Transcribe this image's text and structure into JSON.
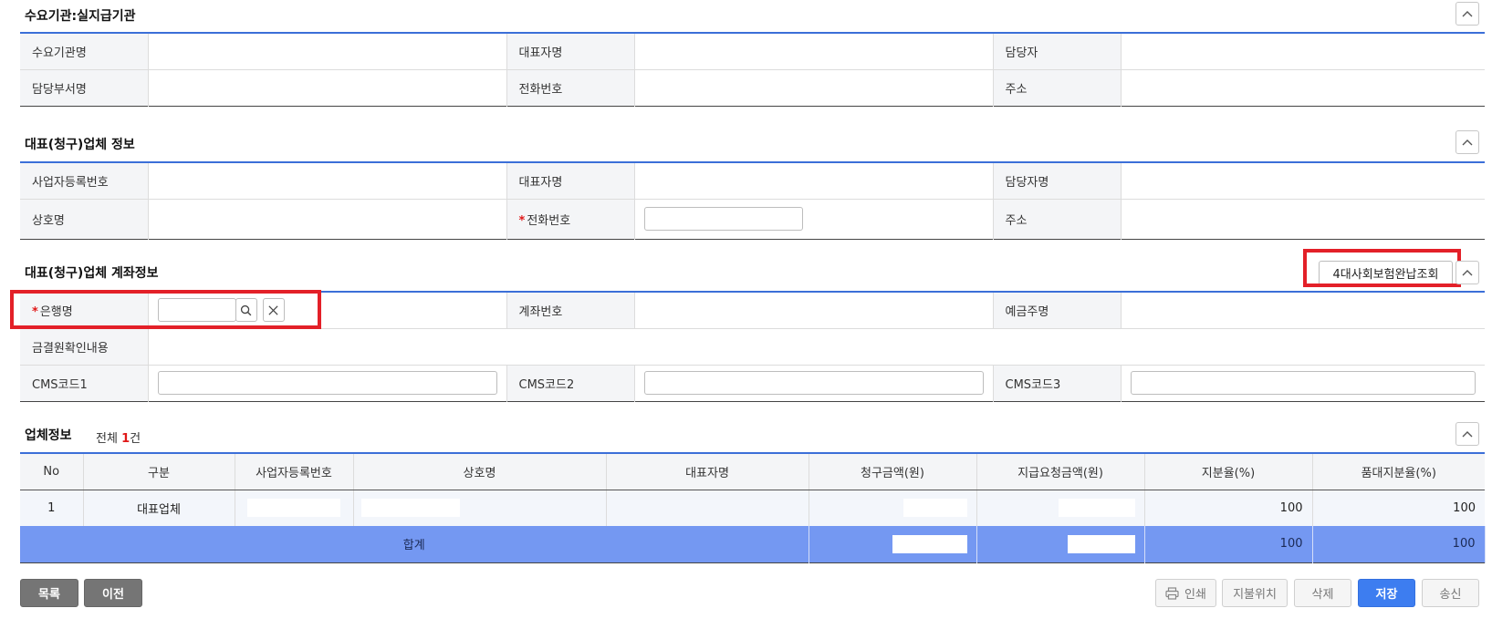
{
  "demand_section": {
    "title": "수요기관:실지급기관",
    "labels": {
      "agency_name": "수요기관명",
      "rep_name": "대표자명",
      "manager": "담당자",
      "dept_name": "담당부서명",
      "phone": "전화번호",
      "address": "주소"
    },
    "values": {
      "agency_name": "",
      "rep_name": "",
      "manager": "",
      "dept_name": "",
      "phone": "",
      "address": ""
    }
  },
  "vendor_section": {
    "title": "대표(청구)업체 정보",
    "labels": {
      "biz_reg_no": "사업자등록번호",
      "rep_name": "대표자명",
      "manager_name": "담당자명",
      "company_name": "상호명",
      "phone": "전화번호",
      "address": "주소"
    },
    "values": {
      "biz_reg_no": "",
      "rep_name": "",
      "manager_name": "",
      "company_name": "",
      "phone": "",
      "address": ""
    }
  },
  "account_section": {
    "title": "대표(청구)업체 계좌정보",
    "insurance_button": "4대사회보험완납조회",
    "labels": {
      "bank_name": "은행명",
      "account_no": "계좌번호",
      "depositor": "예금주명",
      "check_content": "금결원확인내용",
      "cms1": "CMS코드1",
      "cms2": "CMS코드2",
      "cms3": "CMS코드3"
    },
    "values": {
      "bank_name": "",
      "account_no": "",
      "depositor": "",
      "check_content": "",
      "cms1": "",
      "cms2": "",
      "cms3": ""
    }
  },
  "company_section": {
    "title": "업체정보",
    "count_prefix": "전체",
    "count": "1",
    "count_suffix": "건",
    "columns": [
      "No",
      "구분",
      "사업자등록번호",
      "상호명",
      "대표자명",
      "청구금액(원)",
      "지급요청금액(원)",
      "지분율(%)",
      "품대지분율(%)"
    ],
    "rows": [
      {
        "no": "1",
        "type": "대표업체",
        "biz_no": "",
        "name": "",
        "rep": "",
        "claim": "",
        "request": "",
        "share": "100",
        "goods_share": "100"
      }
    ],
    "total": {
      "label": "합계",
      "claim": "",
      "request": "",
      "share": "100",
      "goods_share": "100"
    }
  },
  "buttons": {
    "list": "목록",
    "prev": "이전",
    "print": "인쇄",
    "payment_location": "지불위치",
    "delete": "삭제",
    "save": "저장",
    "send": "송신"
  },
  "colors": {
    "accent": "#3b6fd8",
    "total_row": "#7498f2",
    "highlight": "#e32028",
    "required": "#e01818",
    "primary_button": "#3d7df0"
  }
}
